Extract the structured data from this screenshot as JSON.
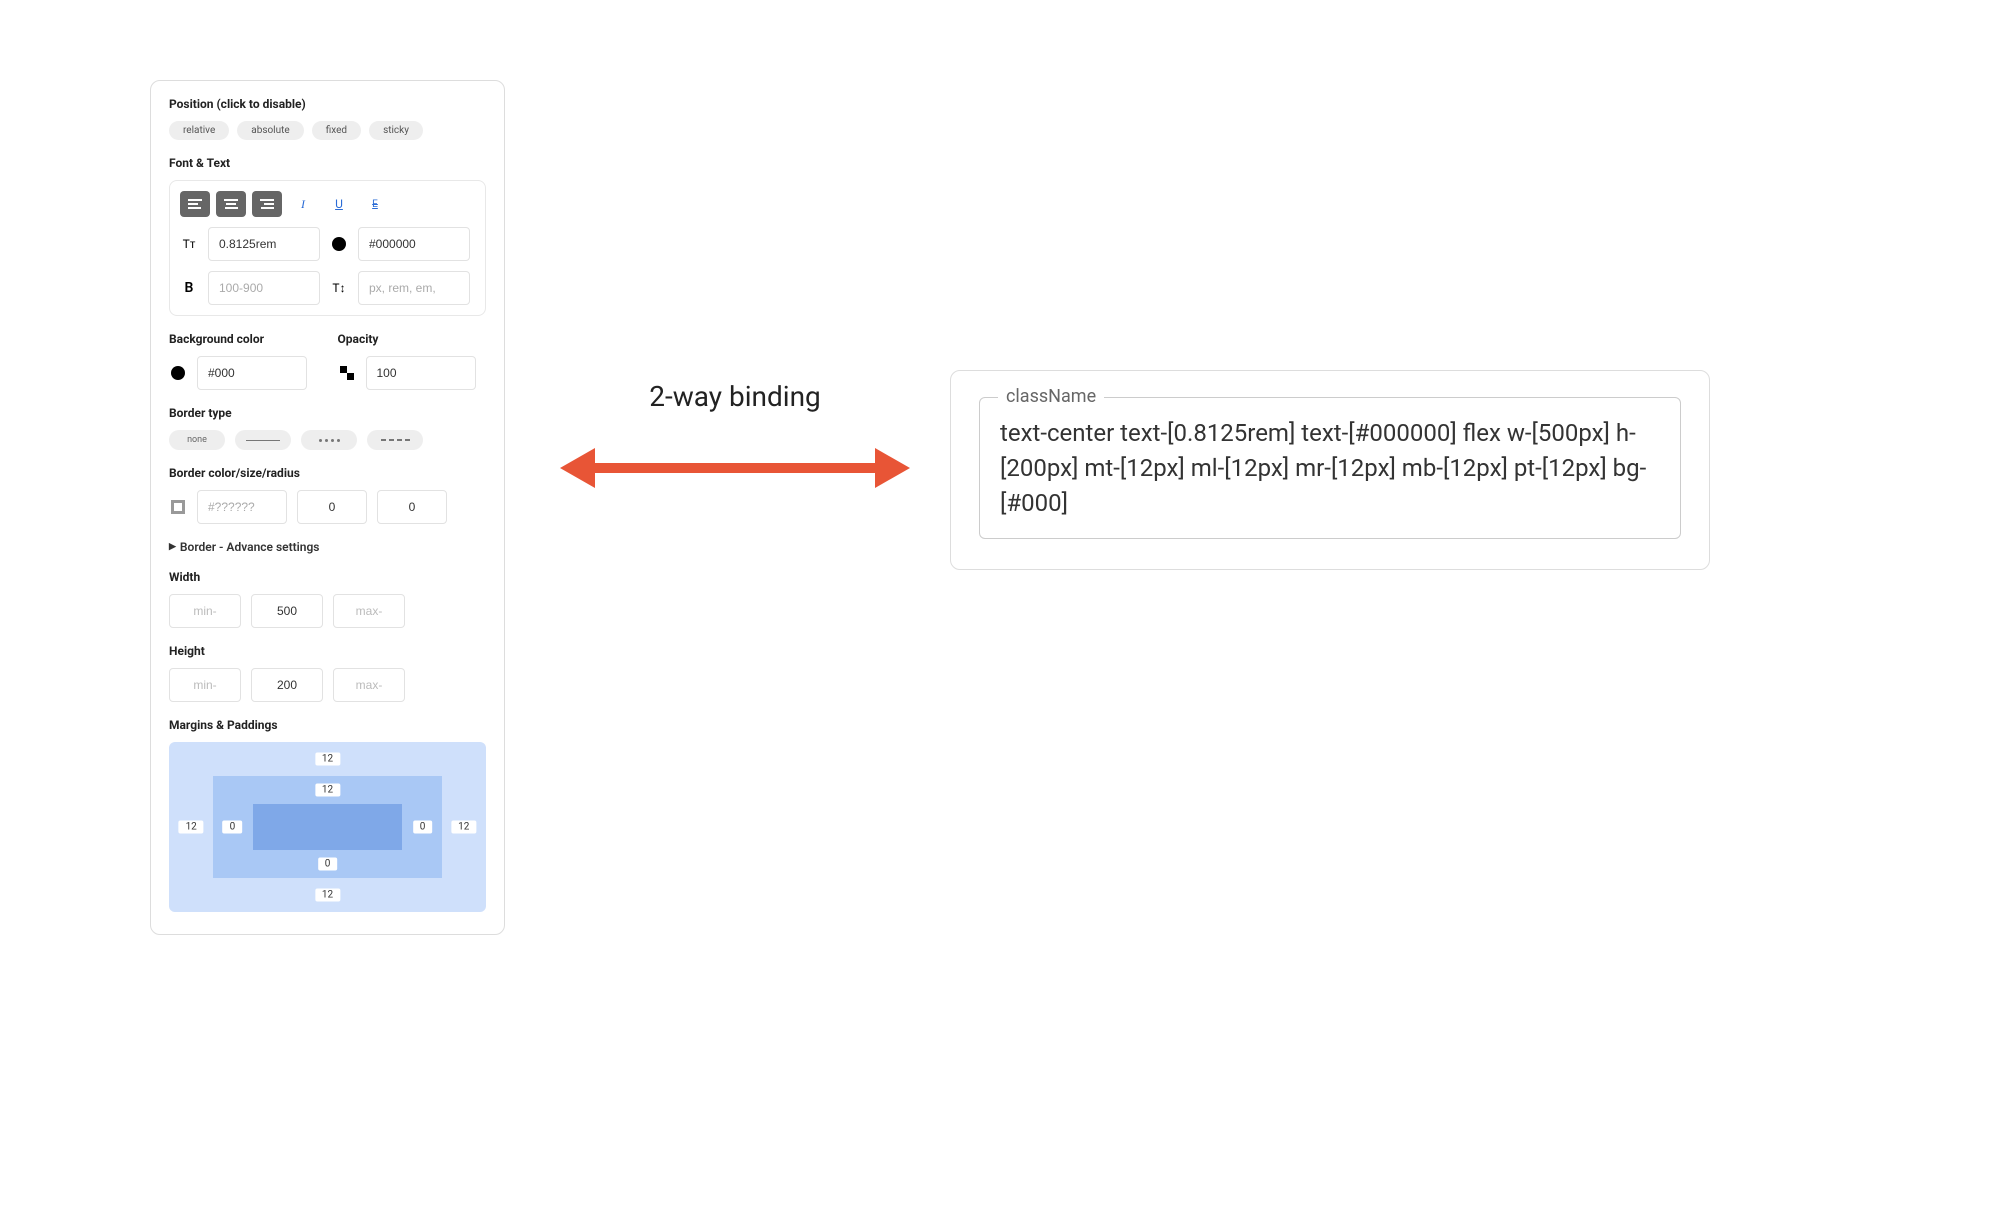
{
  "panel": {
    "position": {
      "label": "Position (click to disable)",
      "options": [
        "relative",
        "absolute",
        "fixed",
        "sticky"
      ]
    },
    "font_text": {
      "label": "Font & Text",
      "italic_glyph": "I",
      "underline_glyph": "U",
      "linethrough_glyph": "E",
      "font_size_glyph": "Tᴛ",
      "font_size_value": "0.8125rem",
      "color_value": "#000000",
      "bold_glyph": "B",
      "weight_placeholder": "100-900",
      "lineheight_glyph": "T↕",
      "lineheight_placeholder": "px, rem, em,"
    },
    "bg_opacity": {
      "bg_label": "Background color",
      "bg_value": "#000",
      "opacity_label": "Opacity",
      "opacity_value": "100"
    },
    "border_type": {
      "label": "Border type",
      "none_label": "none"
    },
    "border_csr": {
      "label": "Border color/size/radius",
      "color_placeholder": "#??????",
      "size_value": "0",
      "radius_value": "0"
    },
    "border_advanced": {
      "label": "Border - Advance settings"
    },
    "width": {
      "label": "Width",
      "min_placeholder": "min-",
      "value": "500",
      "max_placeholder": "max-"
    },
    "height": {
      "label": "Height",
      "min_placeholder": "min-",
      "value": "200",
      "max_placeholder": "max-"
    },
    "margins_paddings": {
      "label": "Margins & Paddings",
      "mt": "12",
      "mr": "12",
      "mb": "12",
      "ml": "12",
      "pt": "12",
      "pr": "0",
      "pb": "0",
      "pl": "0"
    }
  },
  "arrow": {
    "label": "2-way binding"
  },
  "code": {
    "legend": "className",
    "text": "text-center text-[0.8125rem] text-[#000000] flex w-[500px] h-[200px] mt-[12px] ml-[12px] mr-[12px] mb-[12px] pt-[12px] bg-[#000]"
  }
}
